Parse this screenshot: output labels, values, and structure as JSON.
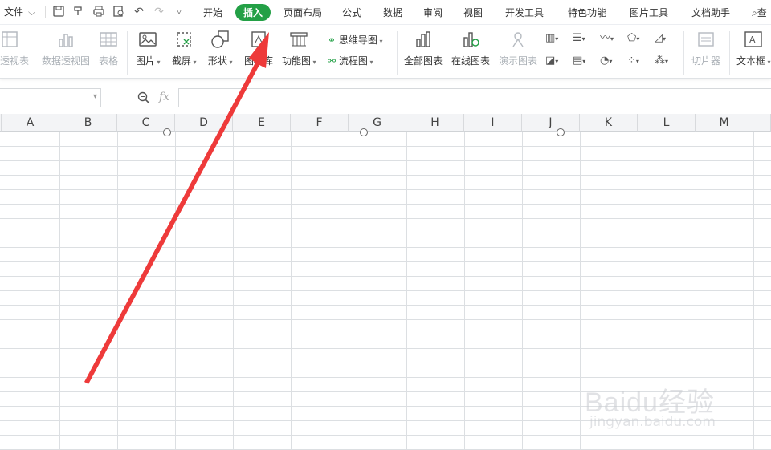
{
  "menubar": {
    "file_label": "文件",
    "tabs": [
      "开始",
      "插入",
      "页面布局",
      "公式",
      "数据",
      "审阅",
      "视图",
      "开发工具",
      "特色功能",
      "图片工具",
      "文档助手"
    ],
    "active_tab": "插入",
    "search_label": "查"
  },
  "ribbon": {
    "pivot_table": "据透视表",
    "pivot_chart": "数据透视图",
    "table": "表格",
    "picture": "图片",
    "screenshot": "截屏",
    "shapes": "形状",
    "icon_library": "图标库",
    "function_chart": "功能图",
    "mind_map": "思维导图",
    "flowchart": "流程图",
    "all_charts": "全部图表",
    "online_charts": "在线图表",
    "demo_charts": "演示图表",
    "slicer": "切片器",
    "text_box": "文本框"
  },
  "sheet": {
    "columns": [
      "A",
      "B",
      "C",
      "D",
      "E",
      "F",
      "G",
      "H",
      "I",
      "J",
      "K",
      "L",
      "M"
    ]
  },
  "watermark": {
    "brand": "Baidu经验",
    "url": "jingyan.baidu.com"
  },
  "colors": {
    "active_tab_bg": "#23a046",
    "arrow": "#ee3a3a"
  }
}
